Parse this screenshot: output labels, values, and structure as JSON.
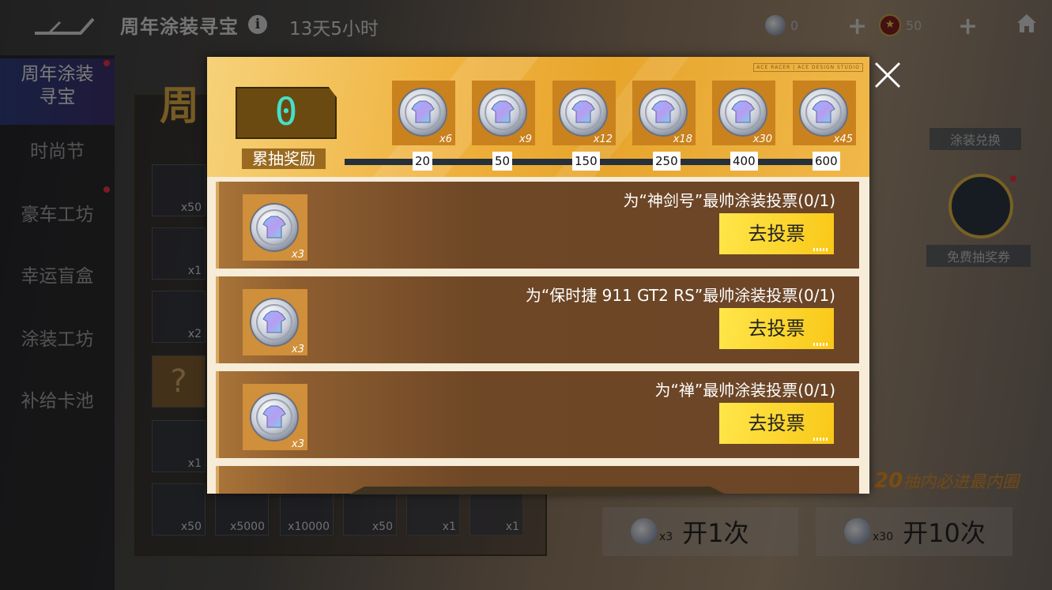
{
  "header": {
    "title": "周年涂装寻宝",
    "countdown": "13天5小时",
    "currency_silver": "0",
    "currency_star": "50"
  },
  "sidebar": {
    "items": [
      {
        "label": "周年涂装\n寻宝",
        "active": true
      },
      {
        "label": "时尚节"
      },
      {
        "label": "豪车工坊"
      },
      {
        "label": "幸运盲盒"
      },
      {
        "label": "涂装工坊"
      },
      {
        "label": "补给卡池"
      }
    ]
  },
  "background": {
    "grid_title_partial": "周",
    "tiles": [
      {
        "qty": "x50"
      },
      {
        "qty": "x1"
      },
      {
        "qty": "x2"
      },
      {
        "qty": "?"
      },
      {
        "qty": "x1"
      },
      {
        "qty": "x50"
      },
      {
        "qty": "x5000"
      },
      {
        "qty": "x10000"
      },
      {
        "qty": "x50"
      },
      {
        "qty": "x1"
      },
      {
        "qty": "x1"
      }
    ],
    "side_exchange_label": "涂装兑换",
    "side_free_label": "免费抽奖券",
    "promo_text": "抽内必进最内圈",
    "promo_number": "20",
    "draw_one": {
      "count": "x3",
      "label": "开1次"
    },
    "draw_ten": {
      "count": "x30",
      "label": "开10次"
    }
  },
  "modal": {
    "brand": "ACE RACER | ACE DESIGN STUDIO",
    "counter_value": "0",
    "counter_label": "累抽奖励",
    "rewards": [
      {
        "qty": "x6",
        "threshold": "20"
      },
      {
        "qty": "x9",
        "threshold": "50"
      },
      {
        "qty": "x12",
        "threshold": "150"
      },
      {
        "qty": "x18",
        "threshold": "250"
      },
      {
        "qty": "x30",
        "threshold": "400"
      },
      {
        "qty": "x45",
        "threshold": "600"
      }
    ],
    "tasks": [
      {
        "title": "为“神剑号”最帅涂装投票(0/1)",
        "reward_qty": "x3",
        "button": "去投票"
      },
      {
        "title": "为“保时捷 911 GT2 RS”最帅涂装投票(0/1)",
        "reward_qty": "x3",
        "button": "去投票"
      },
      {
        "title": "为“禅”最帅涂装投票(0/1)",
        "reward_qty": "x3",
        "button": "去投票"
      }
    ]
  },
  "colors": {
    "accent_gold": "#f0b340",
    "button_yellow": "#ffe64a",
    "counter_cyan": "#45e0c8",
    "task_brown": "#6e4726"
  }
}
